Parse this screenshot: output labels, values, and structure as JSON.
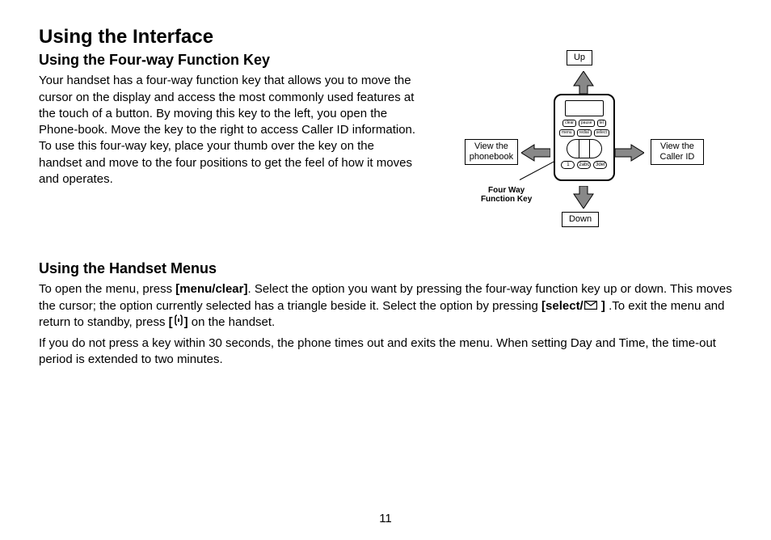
{
  "title": "Using the Interface",
  "section1": {
    "heading": "Using the Four-way Function Key",
    "para": "Your handset has a four-way function key that allows you to move the cursor on the display and access the most commonly used features at the touch of a button. By moving this key to the left, you open the Phone-book. Move the key to the right to access Caller ID information. To use this four-way key, place your thumb over the key on the handset and move to the four positions to get the feel of how it moves and operates."
  },
  "figure": {
    "up": "Up",
    "down": "Down",
    "left": "View the phonebook",
    "right": "View the Caller ID",
    "fn_label_l1": "Four Way",
    "fn_label_l2": "Function Key",
    "device_btns": [
      "clear",
      "pause",
      "tel",
      "menu",
      "redial",
      "select"
    ],
    "device_nums": [
      "1",
      "2abc",
      "3def"
    ]
  },
  "section2": {
    "heading": "Using the Handset Menus",
    "para1_a": "To open the menu, press ",
    "para1_b": "[menu/clear]",
    "para1_c": ". Select the option you want by pressing the four-way function key up or down. This moves the cursor; the option currently selected has a triangle beside it. Select the option by pressing ",
    "para1_d": "[select/",
    "para1_e": " ]",
    "para1_f": " .To exit the menu and return to standby, press ",
    "para1_g": "[",
    "para1_h": "]",
    "para1_i": " on the handset.",
    "para2": "If you do not press a key within 30 seconds, the phone times out and exits the menu. When setting Day and Time, the time-out period is extended to two minutes."
  },
  "page_number": "11"
}
